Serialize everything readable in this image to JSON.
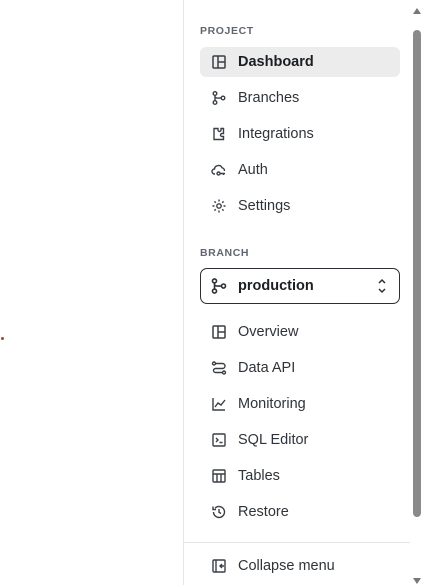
{
  "project_section": {
    "title": "PROJECT",
    "items": [
      {
        "label": "Dashboard",
        "icon": "layout-icon",
        "active": true
      },
      {
        "label": "Branches",
        "icon": "branch-icon"
      },
      {
        "label": "Integrations",
        "icon": "puzzle-icon"
      },
      {
        "label": "Auth",
        "icon": "auth-cloud-key-icon"
      },
      {
        "label": "Settings",
        "icon": "gear-icon"
      }
    ]
  },
  "branch_section": {
    "title": "BRANCH",
    "selected_branch": "production",
    "items": [
      {
        "label": "Overview",
        "icon": "layout-icon"
      },
      {
        "label": "Data API",
        "icon": "route-icon"
      },
      {
        "label": "Monitoring",
        "icon": "line-chart-icon"
      },
      {
        "label": "SQL Editor",
        "icon": "terminal-icon"
      },
      {
        "label": "Tables",
        "icon": "table-icon"
      },
      {
        "label": "Restore",
        "icon": "history-icon"
      }
    ]
  },
  "footer": {
    "collapse_label": "Collapse menu",
    "icon": "collapse-left-icon"
  }
}
